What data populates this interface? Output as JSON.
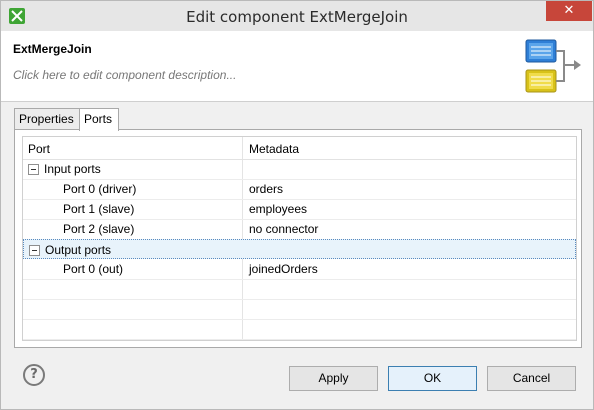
{
  "window": {
    "title": "Edit component ExtMergeJoin",
    "close_symbol": "✕"
  },
  "header": {
    "component_name": "ExtMergeJoin",
    "description_placeholder": "Click here to edit component description..."
  },
  "tabs": [
    {
      "label": "Properties"
    },
    {
      "label": "Ports"
    }
  ],
  "table": {
    "columns": [
      "Port",
      "Metadata"
    ],
    "rows": [
      {
        "port": "Input ports",
        "metadata": ""
      },
      {
        "port": "Port 0 (driver)",
        "metadata": "orders"
      },
      {
        "port": "Port 1 (slave)",
        "metadata": "employees"
      },
      {
        "port": "Port 2 (slave)",
        "metadata": "no connector"
      },
      {
        "port": "Output ports",
        "metadata": ""
      },
      {
        "port": "Port 0 (out)",
        "metadata": "joinedOrders"
      }
    ]
  },
  "buttons": {
    "help": "?",
    "apply": "Apply",
    "ok": "OK",
    "cancel": "Cancel"
  },
  "colors": {
    "title_bar": "#e6e6e6",
    "close": "#c7463a",
    "selection": "#e8f3fb"
  }
}
